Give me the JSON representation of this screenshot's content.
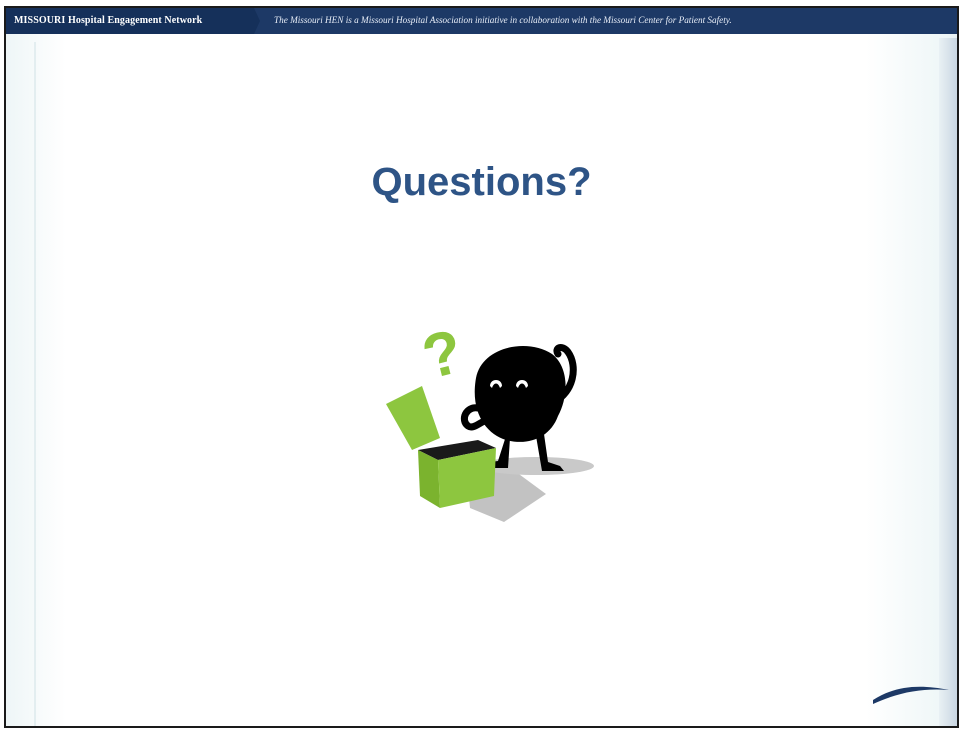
{
  "header": {
    "title": "MISSOURI Hospital Engagement Network",
    "tagline": "The Missouri HEN is a Missouri Hospital Association initiative in collaboration with the Missouri Center for Patient Safety."
  },
  "slide": {
    "title": "Questions?"
  },
  "colors": {
    "header_bg": "#1d3966",
    "title": "#2e5486",
    "box_green": "#8dc63f",
    "question_mark": "#8dc63f"
  },
  "icons": {
    "clipart": "confused-character-with-open-box-icon",
    "corner": "swoosh-decoration"
  }
}
